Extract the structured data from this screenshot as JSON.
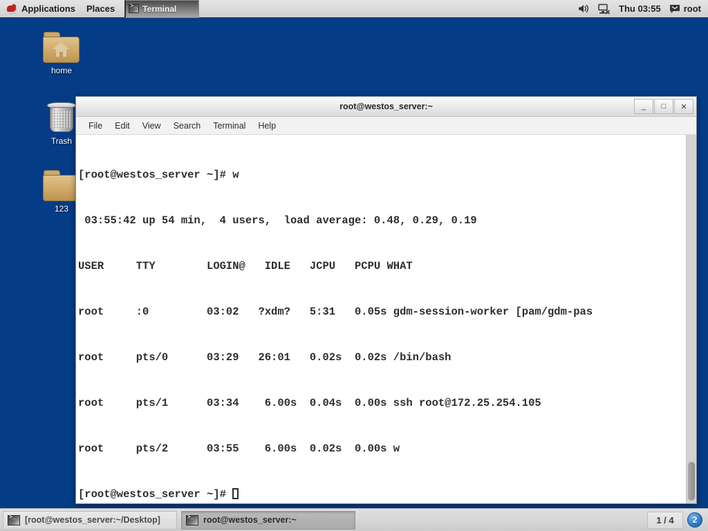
{
  "top_panel": {
    "logo_icon": "redhat-logo-icon",
    "menus": [
      {
        "label": "Applications"
      },
      {
        "label": "Places"
      }
    ],
    "active_window_button": {
      "label": "Terminal",
      "icon": "terminal-icon"
    },
    "tray": {
      "volume_icon": "speaker-icon",
      "network_icon": "network-disconnected-icon",
      "clock": "Thu 03:55",
      "user_icon": "message-icon",
      "user": "root"
    }
  },
  "desktop": {
    "icons": [
      {
        "label": "home",
        "icon": "home-folder-icon"
      },
      {
        "label": "Trash",
        "icon": "trash-icon"
      },
      {
        "label": "123",
        "icon": "folder-icon"
      }
    ]
  },
  "terminal": {
    "title": "root@westos_server:~",
    "window_buttons": {
      "minimize": "_",
      "maximize": "□",
      "close": "✕"
    },
    "menubar": [
      {
        "label": "File"
      },
      {
        "label": "Edit"
      },
      {
        "label": "View"
      },
      {
        "label": "Search"
      },
      {
        "label": "Terminal"
      },
      {
        "label": "Help"
      }
    ],
    "lines": [
      "[root@westos_server ~]# w",
      " 03:55:42 up 54 min,  4 users,  load average: 0.48, 0.29, 0.19",
      "USER     TTY        LOGIN@   IDLE   JCPU   PCPU WHAT",
      "root     :0         03:02   ?xdm?   5:31   0.05s gdm-session-worker [pam/gdm-pas",
      "root     pts/0      03:29   26:01   0.02s  0.02s /bin/bash",
      "root     pts/1      03:34    6.00s  0.04s  0.00s ssh root@172.25.254.105",
      "root     pts/2      03:55    6.00s  0.02s  0.00s w"
    ],
    "prompt": "[root@westos_server ~]# ",
    "command_executed": "w",
    "uptime": "54 min",
    "user_count": "4 users",
    "load_average": [
      "0.48",
      "0.29",
      "0.19"
    ],
    "sessions": [
      {
        "user": "root",
        "tty": ":0",
        "login": "03:02",
        "idle": "?xdm?",
        "jcpu": "5:31",
        "pcpu": "0.05s",
        "what": "gdm-session-worker [pam/gdm-pas"
      },
      {
        "user": "root",
        "tty": "pts/0",
        "login": "03:29",
        "idle": "26:01",
        "jcpu": "0.02s",
        "pcpu": "0.02s",
        "what": "/bin/bash"
      },
      {
        "user": "root",
        "tty": "pts/1",
        "login": "03:34",
        "idle": "6.00s",
        "jcpu": "0.04s",
        "pcpu": "0.00s",
        "what": "ssh root@172.25.254.105"
      },
      {
        "user": "root",
        "tty": "pts/2",
        "login": "03:55",
        "idle": "6.00s",
        "jcpu": "0.02s",
        "pcpu": "0.00s",
        "what": "w"
      }
    ]
  },
  "bottom_panel": {
    "tasks": [
      {
        "label": "[root@westos_server:~/Desktop]",
        "active": false,
        "icon": "terminal-icon"
      },
      {
        "label": "root@westos_server:~",
        "active": true,
        "icon": "terminal-icon"
      }
    ],
    "workspace": "1 / 4",
    "notification_count": "2"
  },
  "colors": {
    "desktop_background": "#053c86",
    "panel_background": "#d6d6d6",
    "panel_border": "#0a3a7d",
    "terminal_background": "#ffffff",
    "terminal_text": "#2d2d2d",
    "notification_badge": "#2f7fd0"
  }
}
